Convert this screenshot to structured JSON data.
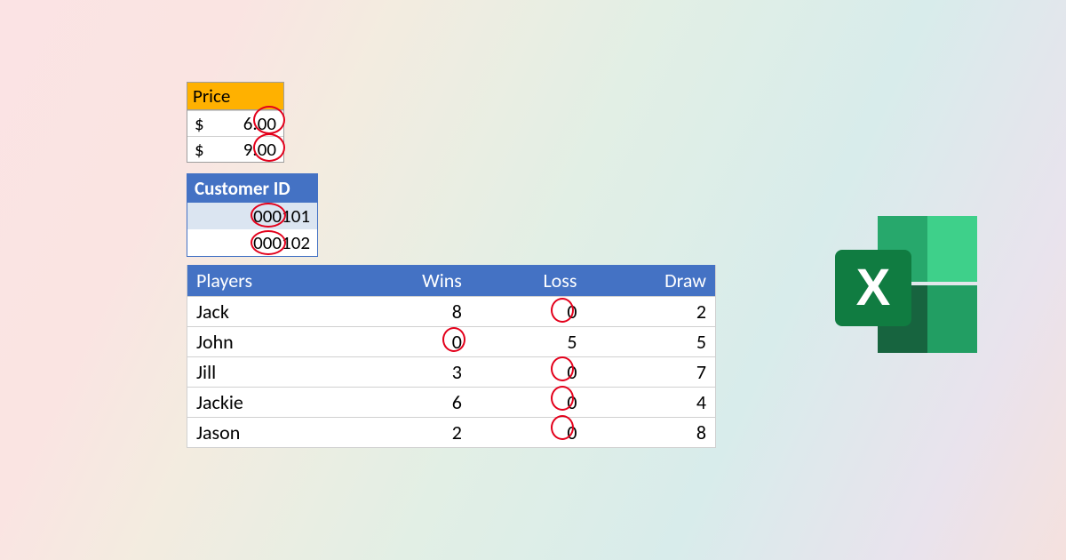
{
  "price": {
    "header": "Price",
    "rows": [
      {
        "currency": "$",
        "value": "6.00"
      },
      {
        "currency": "$",
        "value": "9.00"
      }
    ]
  },
  "customer": {
    "header": "Customer ID",
    "rows": [
      "000101",
      "000102"
    ]
  },
  "players": {
    "headers": {
      "players": "Players",
      "wins": "Wins",
      "loss": "Loss",
      "draw": "Draw"
    },
    "rows": [
      {
        "name": "Jack",
        "wins": "8",
        "loss": "0",
        "draw": "2"
      },
      {
        "name": "John",
        "wins": "0",
        "loss": "5",
        "draw": "5"
      },
      {
        "name": "Jill",
        "wins": "3",
        "loss": "0",
        "draw": "7"
      },
      {
        "name": "Jackie",
        "wins": "6",
        "loss": "0",
        "draw": "4"
      },
      {
        "name": "Jason",
        "wins": "2",
        "loss": "0",
        "draw": "8"
      }
    ]
  },
  "icon": {
    "name": "excel-icon",
    "letter": "X"
  }
}
